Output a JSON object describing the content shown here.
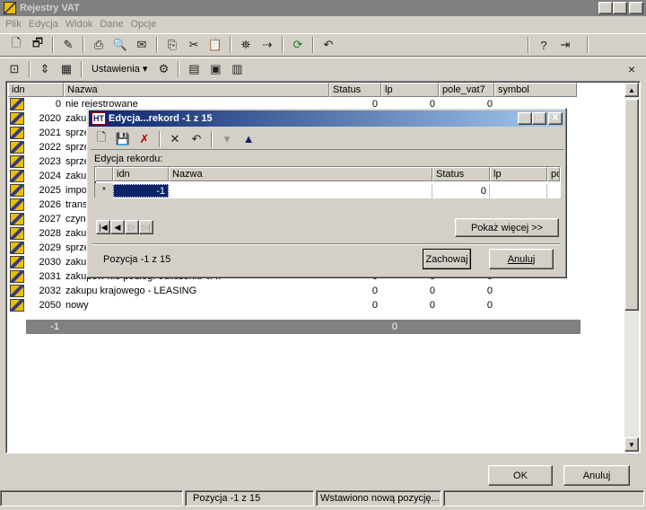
{
  "window": {
    "title": "Rejestry VAT",
    "controls": [
      "_",
      "□",
      "X"
    ]
  },
  "menu": [
    "Plik",
    "Edycja",
    "Widok",
    "Dane",
    "Opcje"
  ],
  "toolbar2": {
    "settings_label": "Ustawienia ▾",
    "close": "×"
  },
  "grid": {
    "columns": [
      "idn",
      "Nazwa",
      "Status",
      "lp",
      "pole_vat7",
      "symbol"
    ],
    "rows": [
      {
        "idn": "0",
        "nazwa": "nie rejestrowane",
        "status": "0",
        "lp": "0",
        "pv": "0"
      },
      {
        "idn": "2020",
        "nazwa": "zakup",
        "status": "",
        "lp": "",
        "pv": ""
      },
      {
        "idn": "2021",
        "nazwa": "sprze",
        "status": "",
        "lp": "",
        "pv": ""
      },
      {
        "idn": "2022",
        "nazwa": "sprze",
        "status": "",
        "lp": "",
        "pv": ""
      },
      {
        "idn": "2023",
        "nazwa": "sprze",
        "status": "",
        "lp": "",
        "pv": ""
      },
      {
        "idn": "2024",
        "nazwa": "zakup",
        "status": "",
        "lp": "",
        "pv": ""
      },
      {
        "idn": "2025",
        "nazwa": "impor",
        "status": "",
        "lp": "",
        "pv": ""
      },
      {
        "idn": "2026",
        "nazwa": "trans",
        "status": "",
        "lp": "",
        "pv": ""
      },
      {
        "idn": "2027",
        "nazwa": "czynr",
        "status": "",
        "lp": "",
        "pv": ""
      },
      {
        "idn": "2028",
        "nazwa": "zakup",
        "status": "",
        "lp": "",
        "pv": ""
      },
      {
        "idn": "2029",
        "nazwa": "sprze",
        "status": "",
        "lp": "",
        "pv": ""
      },
      {
        "idn": "2030",
        "nazwa": "zakup",
        "status": "",
        "lp": "",
        "pv": ""
      },
      {
        "idn": "2031",
        "nazwa": "zakupów nie podleg. odliczeniu VAT",
        "status": "0",
        "lp": "0",
        "pv": "0"
      },
      {
        "idn": "2032",
        "nazwa": "zakupu krajowego - LEASING",
        "status": "0",
        "lp": "0",
        "pv": "0"
      },
      {
        "idn": "2050",
        "nazwa": "nowy",
        "status": "0",
        "lp": "0",
        "pv": "0"
      }
    ],
    "new_row": {
      "idn": "-1",
      "status": "0"
    }
  },
  "buttons": {
    "ok": "OK",
    "cancel": "Anuluj"
  },
  "statusbar": {
    "position": "Pozycja -1 z 15",
    "message": "Wstawiono nową pozycję..."
  },
  "dialog": {
    "icon_text": "HT",
    "title": "Edycja...rekord -1 z 15",
    "section_label": "Edycja rekordu:",
    "columns": [
      "idn",
      "Nazwa",
      "Status",
      "lp",
      "pol"
    ],
    "row": {
      "indicator": "*",
      "idn": "-1",
      "nazwa": "",
      "status": "0"
    },
    "show_more": "Pokaż więcej >>",
    "position": "Pozycja -1 z 15",
    "save": "Zachowaj",
    "cancel": "Anuluj"
  }
}
